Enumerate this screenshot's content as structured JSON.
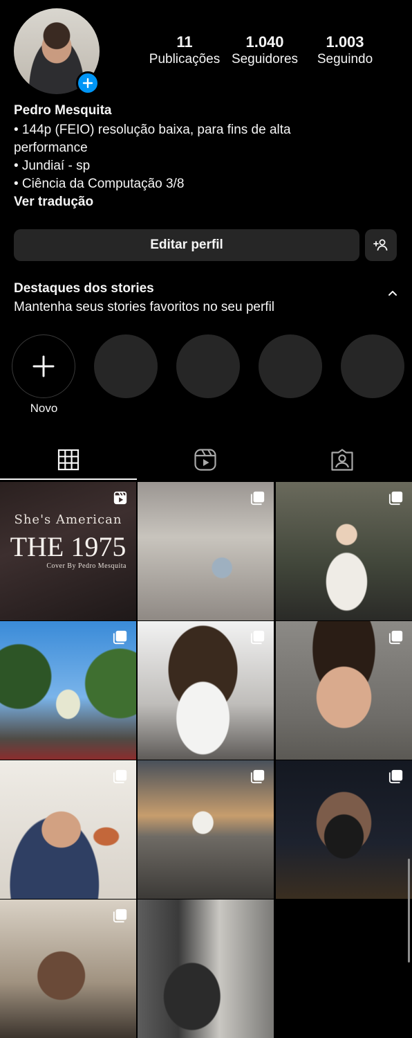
{
  "profile": {
    "name": "Pedro Mesquita",
    "avatar_badge_icon": "plus-icon",
    "stats": [
      {
        "value": "11",
        "label": "Publicações"
      },
      {
        "value": "1.040",
        "label": "Seguidores"
      },
      {
        "value": "1.003",
        "label": "Seguindo"
      }
    ],
    "bio": [
      "• 144p (FEIO) resolução baixa, para fins de alta",
      "performance",
      "• Jundiaí - sp",
      "• Ciência da Computação 3/8"
    ],
    "see_translation": "Ver tradução"
  },
  "actions": {
    "edit_profile": "Editar perfil",
    "discover_people_icon": "add-person-icon"
  },
  "highlights": {
    "title": "Destaques dos stories",
    "subtitle": "Mantenha seus stories favoritos no seu perfil",
    "new_label": "Novo",
    "placeholder_count": 4
  },
  "tabs": [
    {
      "icon": "grid-icon",
      "selected": true
    },
    {
      "icon": "reels-icon",
      "selected": false
    },
    {
      "icon": "tagged-icon",
      "selected": false
    }
  ],
  "grid": {
    "posts": [
      {
        "type": "reel",
        "badge": "reels-icon",
        "title_lines": [
          "She's American",
          "THE 1975",
          "Cover By Pedro Mesquita"
        ]
      },
      {
        "type": "carousel",
        "badge": "carousel-icon"
      },
      {
        "type": "carousel",
        "badge": "carousel-icon"
      },
      {
        "type": "carousel",
        "badge": "carousel-icon"
      },
      {
        "type": "carousel",
        "badge": "carousel-icon"
      },
      {
        "type": "carousel",
        "badge": "carousel-icon"
      },
      {
        "type": "carousel",
        "badge": "carousel-icon"
      },
      {
        "type": "carousel",
        "badge": "carousel-icon"
      },
      {
        "type": "carousel",
        "badge": "carousel-icon"
      },
      {
        "type": "carousel",
        "badge": "carousel-icon"
      },
      {
        "type": "photo"
      }
    ]
  },
  "colors": {
    "background": "#000000",
    "button": "#262626",
    "accent": "#0095f6",
    "text": "#f5f5f5"
  }
}
